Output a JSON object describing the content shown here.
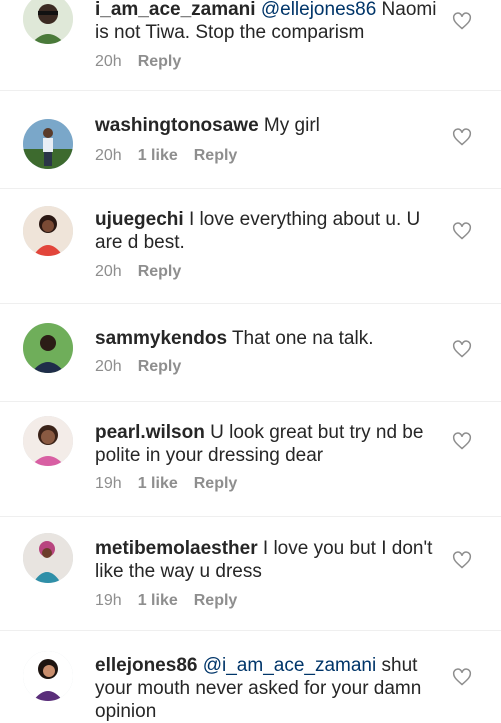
{
  "comments": [
    {
      "username": "i_am_ace_zamani",
      "mention": "@ellejones86",
      "text": " Naomi is not Tiwa.  Stop the comparism",
      "time": "20h",
      "likes": "",
      "reply": "Reply"
    },
    {
      "username": "washingtonosawe",
      "mention": "",
      "text": " My girl",
      "time": "20h",
      "likes": "1 like",
      "reply": "Reply"
    },
    {
      "username": "ujuegechi",
      "mention": "",
      "text": " I love everything about u.  U are d best.",
      "time": "20h",
      "likes": "",
      "reply": "Reply"
    },
    {
      "username": "sammykendos",
      "mention": "",
      "text": " That one na talk.",
      "time": "20h",
      "likes": "",
      "reply": "Reply"
    },
    {
      "username": "pearl.wilson",
      "mention": "",
      "text": " U look great but try nd be polite in your dressing dear",
      "time": "19h",
      "likes": "1 like",
      "reply": "Reply"
    },
    {
      "username": "metibemolaesther",
      "mention": "",
      "text": " I love you but I don't like the way u dress",
      "time": "19h",
      "likes": "1 like",
      "reply": "Reply"
    },
    {
      "username": "ellejones86",
      "mention": "@i_am_ace_zamani",
      "text": " shut your mouth never asked for your damn opinion",
      "time": "",
      "likes": "",
      "reply": ""
    }
  ],
  "icons": {
    "like": "heart-outline-icon"
  },
  "colors": {
    "mention": "#003569",
    "meta": "#8e8e8e",
    "divider": "#efefef"
  }
}
